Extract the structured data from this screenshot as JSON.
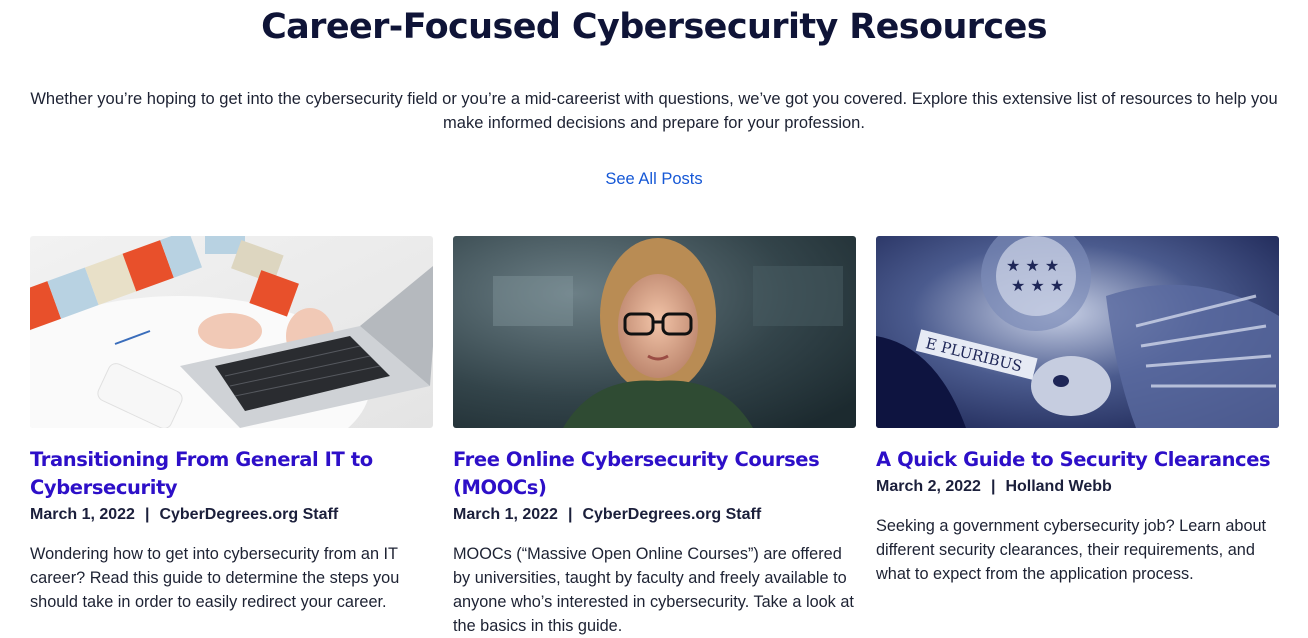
{
  "section": {
    "title": "Career-Focused Cybersecurity Resources",
    "intro": "Whether you’re hoping to get into the cybersecurity field or you’re a mid-careerist with questions, we’ve got you covered. Explore this extensive list of resources to help you make informed decisions and prepare for your profession.",
    "see_all": "See All Posts"
  },
  "separator": "|",
  "posts": [
    {
      "title": "Transitioning From General IT to Cybersecurity",
      "date": "March 1, 2022",
      "author": "CyberDegrees.org Staff",
      "excerpt": "Wondering how to get into cybersecurity from an IT career? Read this guide to determine the steps you should take in order to easily redirect your career.",
      "image": "person-typing-on-laptop-photo"
    },
    {
      "title": "Free Online Cybersecurity Courses (MOOCs)",
      "date": "March 1, 2022",
      "author": "CyberDegrees.org Staff",
      "excerpt": "MOOCs (“Massive Open Online Courses”) are offered by universities, taught by faculty and freely available to anyone who’s interested in cybersecurity. Take a look at the basics in this guide.",
      "image": "woman-with-glasses-at-screen-photo"
    },
    {
      "title": "A Quick Guide to Security Clearances",
      "date": "March 2, 2022",
      "author": "Holland Webb",
      "excerpt": "Seeking a government cybersecurity job? Learn about different security clearances, their requirements, and what to expect from the application process.",
      "image": "great-seal-eagle-photo",
      "image_text": "E PLURIBUS"
    }
  ],
  "colors": {
    "heading": "#0f1437",
    "link": "#1658d6",
    "card_title": "#2d0fc8",
    "body_text": "#1d2233"
  }
}
